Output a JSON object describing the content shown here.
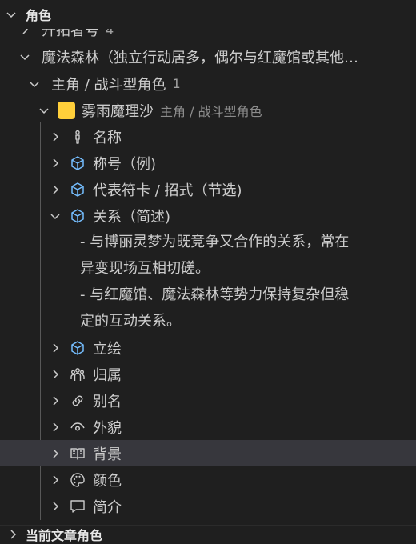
{
  "section_top": {
    "title": "角色"
  },
  "tree": {
    "partial_item": {
      "label": "开拓者号",
      "count": "4"
    },
    "group": {
      "label": "魔法森林（独立行动居多，偶尔与红魔馆或其他…"
    },
    "subgroup": {
      "label": "主角 / 战斗型角色",
      "count": "1"
    },
    "character": {
      "label": "雾雨魔理沙",
      "desc": "主角 / 战斗型角色",
      "chip_color": "#ffcf3a"
    },
    "fields": [
      {
        "label": "名称",
        "icon": "person-icon"
      },
      {
        "label": "称号（例)",
        "icon": "cube-icon"
      },
      {
        "label": "代表符卡 / 招式（节选)",
        "icon": "cube-icon"
      },
      {
        "label": "关系（简述)",
        "icon": "cube-icon"
      }
    ],
    "relation_lines": [
      "- 与博丽灵梦为既竞争又合作的关系，常在",
      "异变现场互相切磋。",
      "- 与红魔馆、魔法森林等势力保持复杂但稳",
      "定的互动关系。"
    ],
    "fields_after": [
      {
        "label": "立绘",
        "icon": "cube-icon"
      },
      {
        "label": "归属",
        "icon": "group-icon"
      },
      {
        "label": "别名",
        "icon": "link-icon"
      },
      {
        "label": "外貌",
        "icon": "eye-icon"
      },
      {
        "label": "背景",
        "icon": "book-icon"
      },
      {
        "label": "颜色",
        "icon": "palette-icon"
      },
      {
        "label": "简介",
        "icon": "comment-icon"
      }
    ]
  },
  "section_bottom": {
    "title": "当前文章角色"
  },
  "colors": {
    "accent_icon": "#75beff",
    "selected_row": "#37373d"
  }
}
